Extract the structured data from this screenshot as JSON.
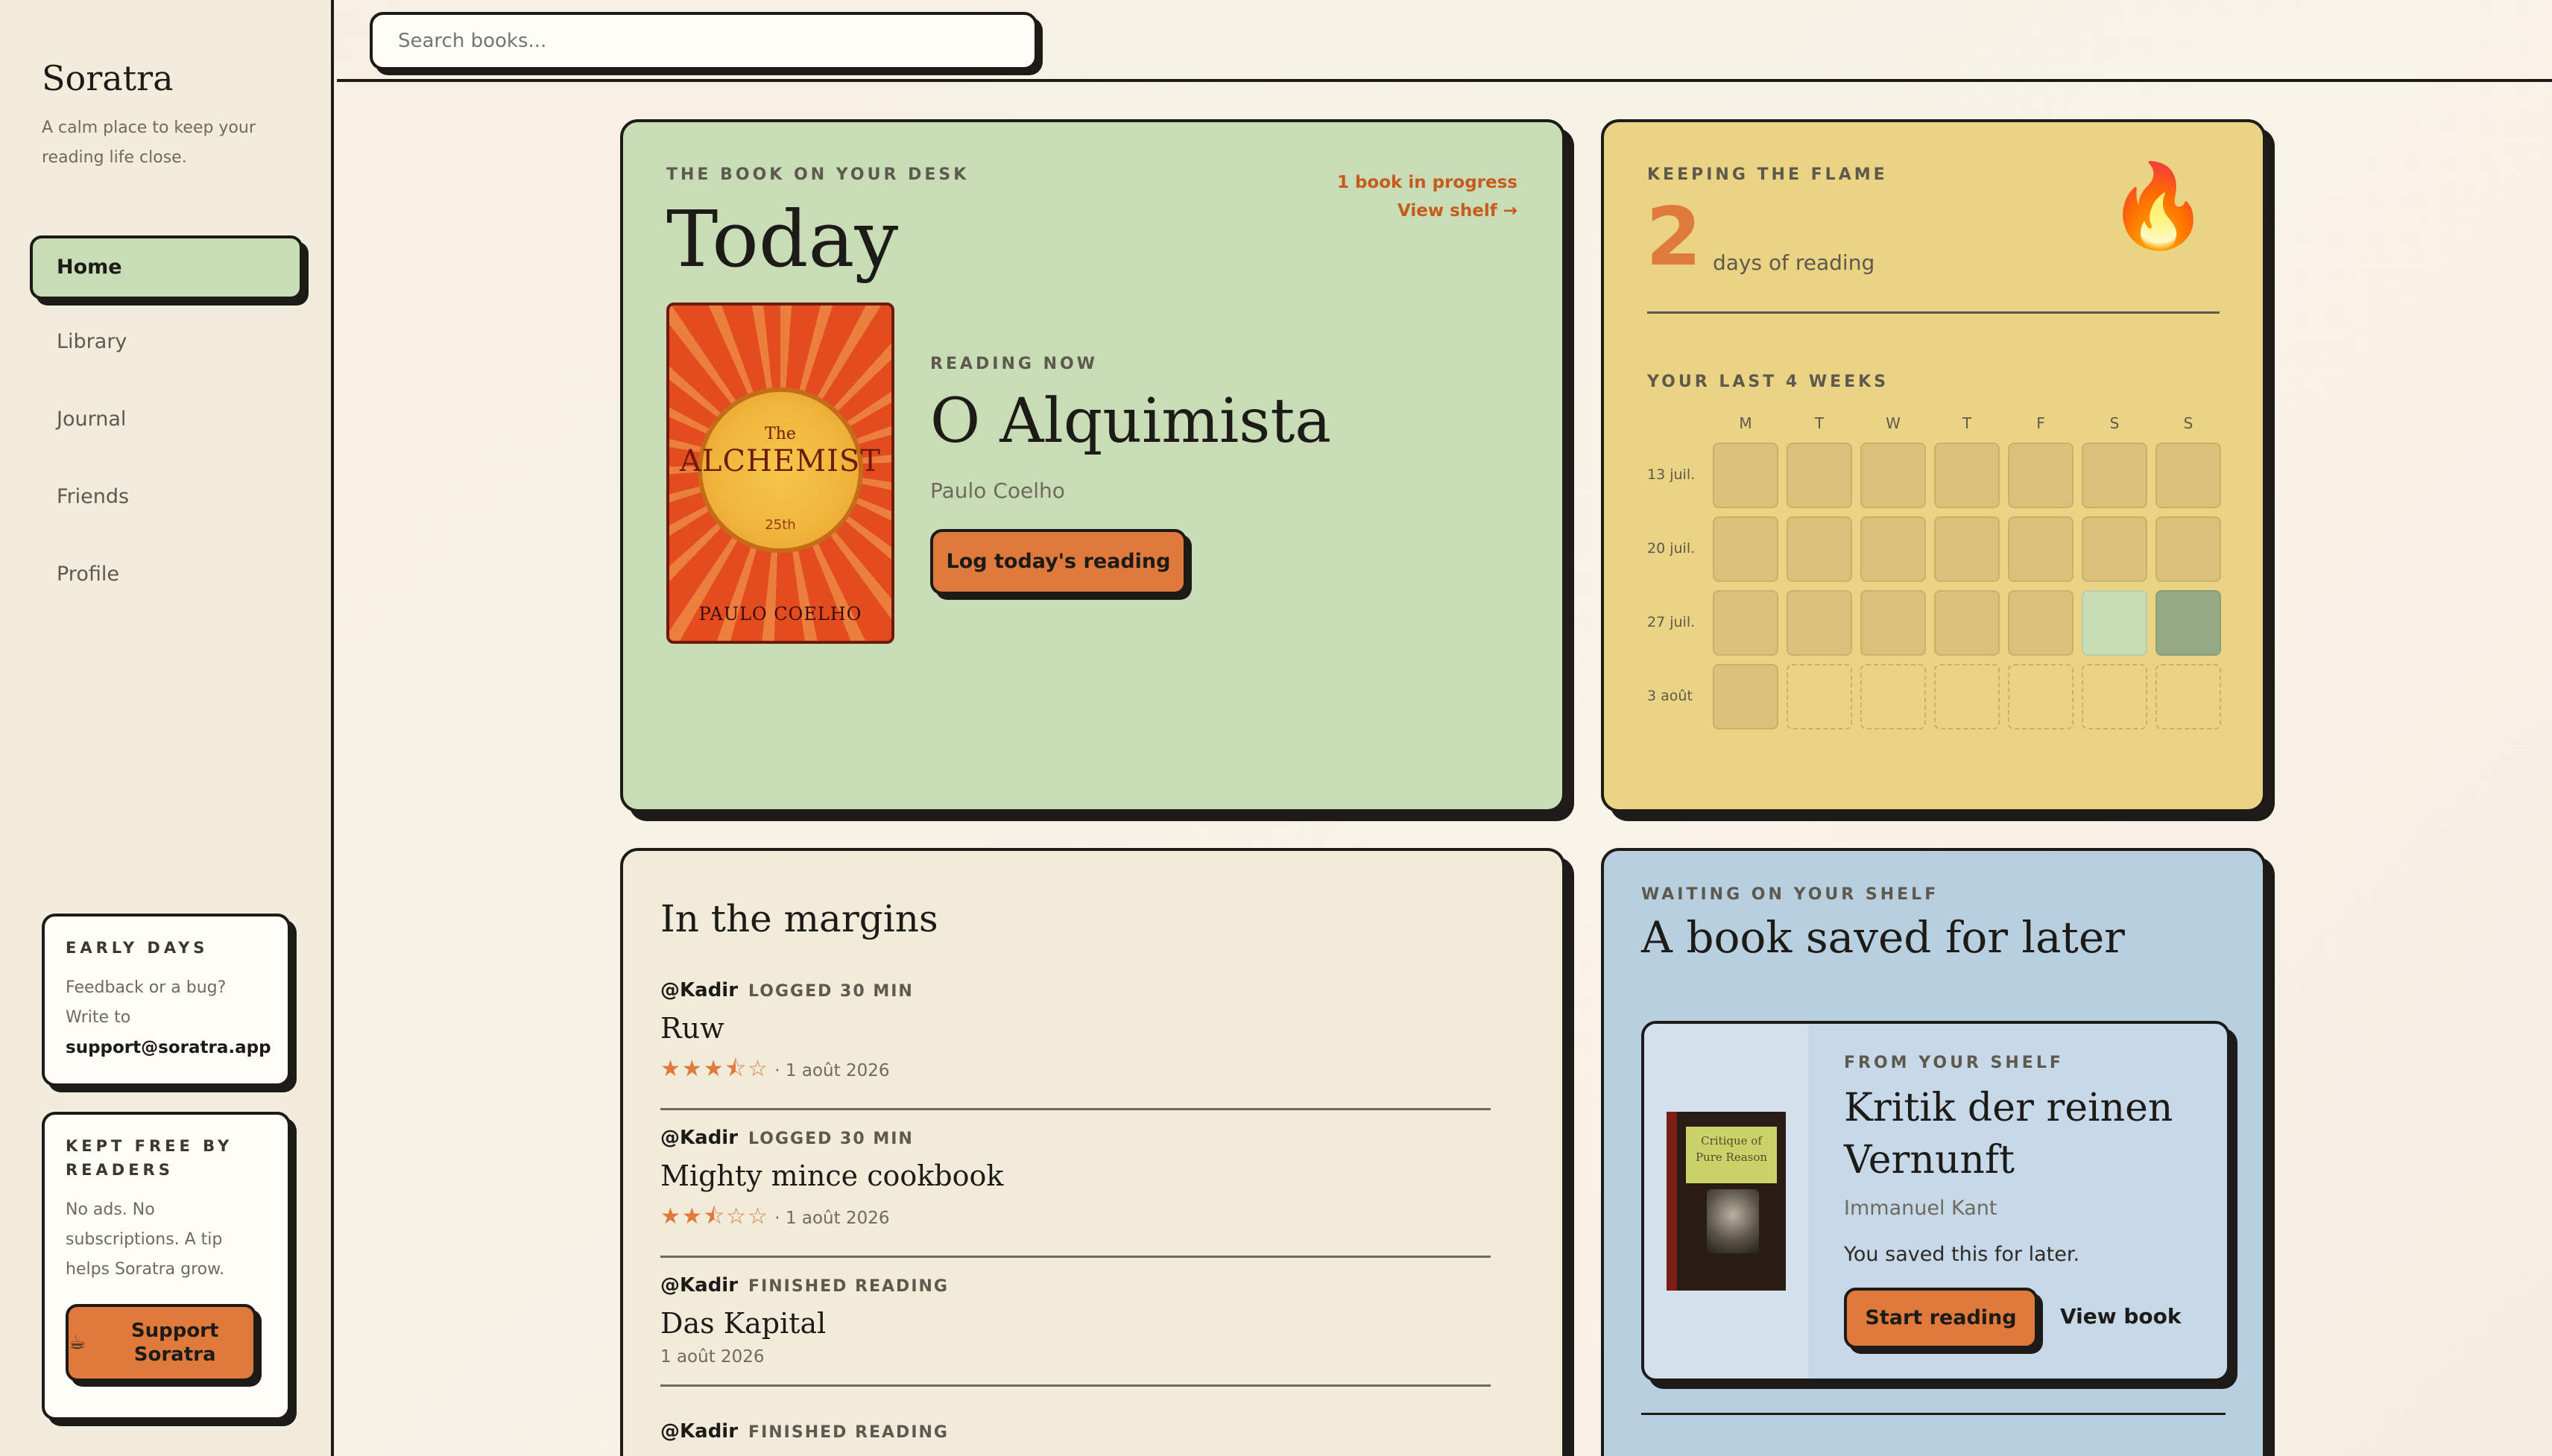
{
  "sidebar": {
    "brand": "Soratra",
    "tagline": "A calm place to keep your reading life close.",
    "nav": [
      "Home",
      "Library",
      "Journal",
      "Friends",
      "Profile"
    ],
    "early": {
      "eyebrow": "EARLY DAYS",
      "text": "Feedback or a bug? Write to",
      "email": "support@soratra.app"
    },
    "kept": {
      "eyebrow": "KEPT FREE BY READERS",
      "text": "No ads. No subscriptions. A tip helps Soratra grow.",
      "button": "Support Soratra"
    }
  },
  "search": {
    "placeholder": "Search books..."
  },
  "today": {
    "eyebrow": "THE BOOK ON YOUR DESK",
    "title": "Today",
    "progress": "1 book in progress",
    "view_shelf": "View shelf →",
    "reading_label": "READING NOW",
    "book_title": "O Alquimista",
    "author": "Paulo Coelho",
    "log_button": "Log today's reading",
    "cover": {
      "the": "The",
      "title": "ALCHEMIST",
      "edition": "25th",
      "author": "PAULO COELHO"
    }
  },
  "flame": {
    "eyebrow": "KEEPING THE FLAME",
    "count": "2",
    "days_label": "days of reading",
    "weeks_label": "YOUR LAST 4 WEEKS",
    "day_heads": [
      "M",
      "T",
      "W",
      "T",
      "F",
      "S",
      "S"
    ],
    "weeks": [
      {
        "label": "13 juil.",
        "cells": [
          "none",
          "none",
          "none",
          "none",
          "none",
          "none",
          "none"
        ]
      },
      {
        "label": "20 juil.",
        "cells": [
          "none",
          "none",
          "none",
          "none",
          "none",
          "none",
          "none"
        ]
      },
      {
        "label": "27 juil.",
        "cells": [
          "none",
          "none",
          "none",
          "none",
          "none",
          "light",
          "dark"
        ]
      },
      {
        "label": "3 août",
        "cells": [
          "none",
          "empty",
          "empty",
          "empty",
          "empty",
          "empty",
          "empty"
        ]
      }
    ]
  },
  "margins": {
    "heading": "In the margins",
    "entries": [
      {
        "user": "@Kadir",
        "action": "LOGGED 30 MIN",
        "title": "Ruw",
        "stars": "★★★⯪☆",
        "date": "1 août 2026"
      },
      {
        "user": "@Kadir",
        "action": "LOGGED 30 MIN",
        "title": "Mighty mince cookbook",
        "stars": "★★⯪☆☆",
        "date": "1 août 2026"
      },
      {
        "user": "@Kadir",
        "action": "FINISHED READING",
        "title": "Das Kapital",
        "stars": "",
        "date": "1 août 2026"
      },
      {
        "user": "@Kadir",
        "action": "FINISHED READING",
        "title": "",
        "stars": "",
        "date": ""
      }
    ]
  },
  "shelf": {
    "eyebrow": "WAITING ON YOUR SHELF",
    "heading": "A book saved for later",
    "from": "FROM YOUR SHELF",
    "title": "Kritik der reinen Vernunft",
    "author": "Immanuel Kant",
    "note": "You saved this for later.",
    "start_button": "Start reading",
    "view_link": "View book",
    "cover_label": "Critique of Pure Reason"
  },
  "colors": {
    "accent": "#e07a3c",
    "green": "#c8ddb6",
    "yellow": "#ebd384",
    "blue": "#b8cfe0"
  }
}
